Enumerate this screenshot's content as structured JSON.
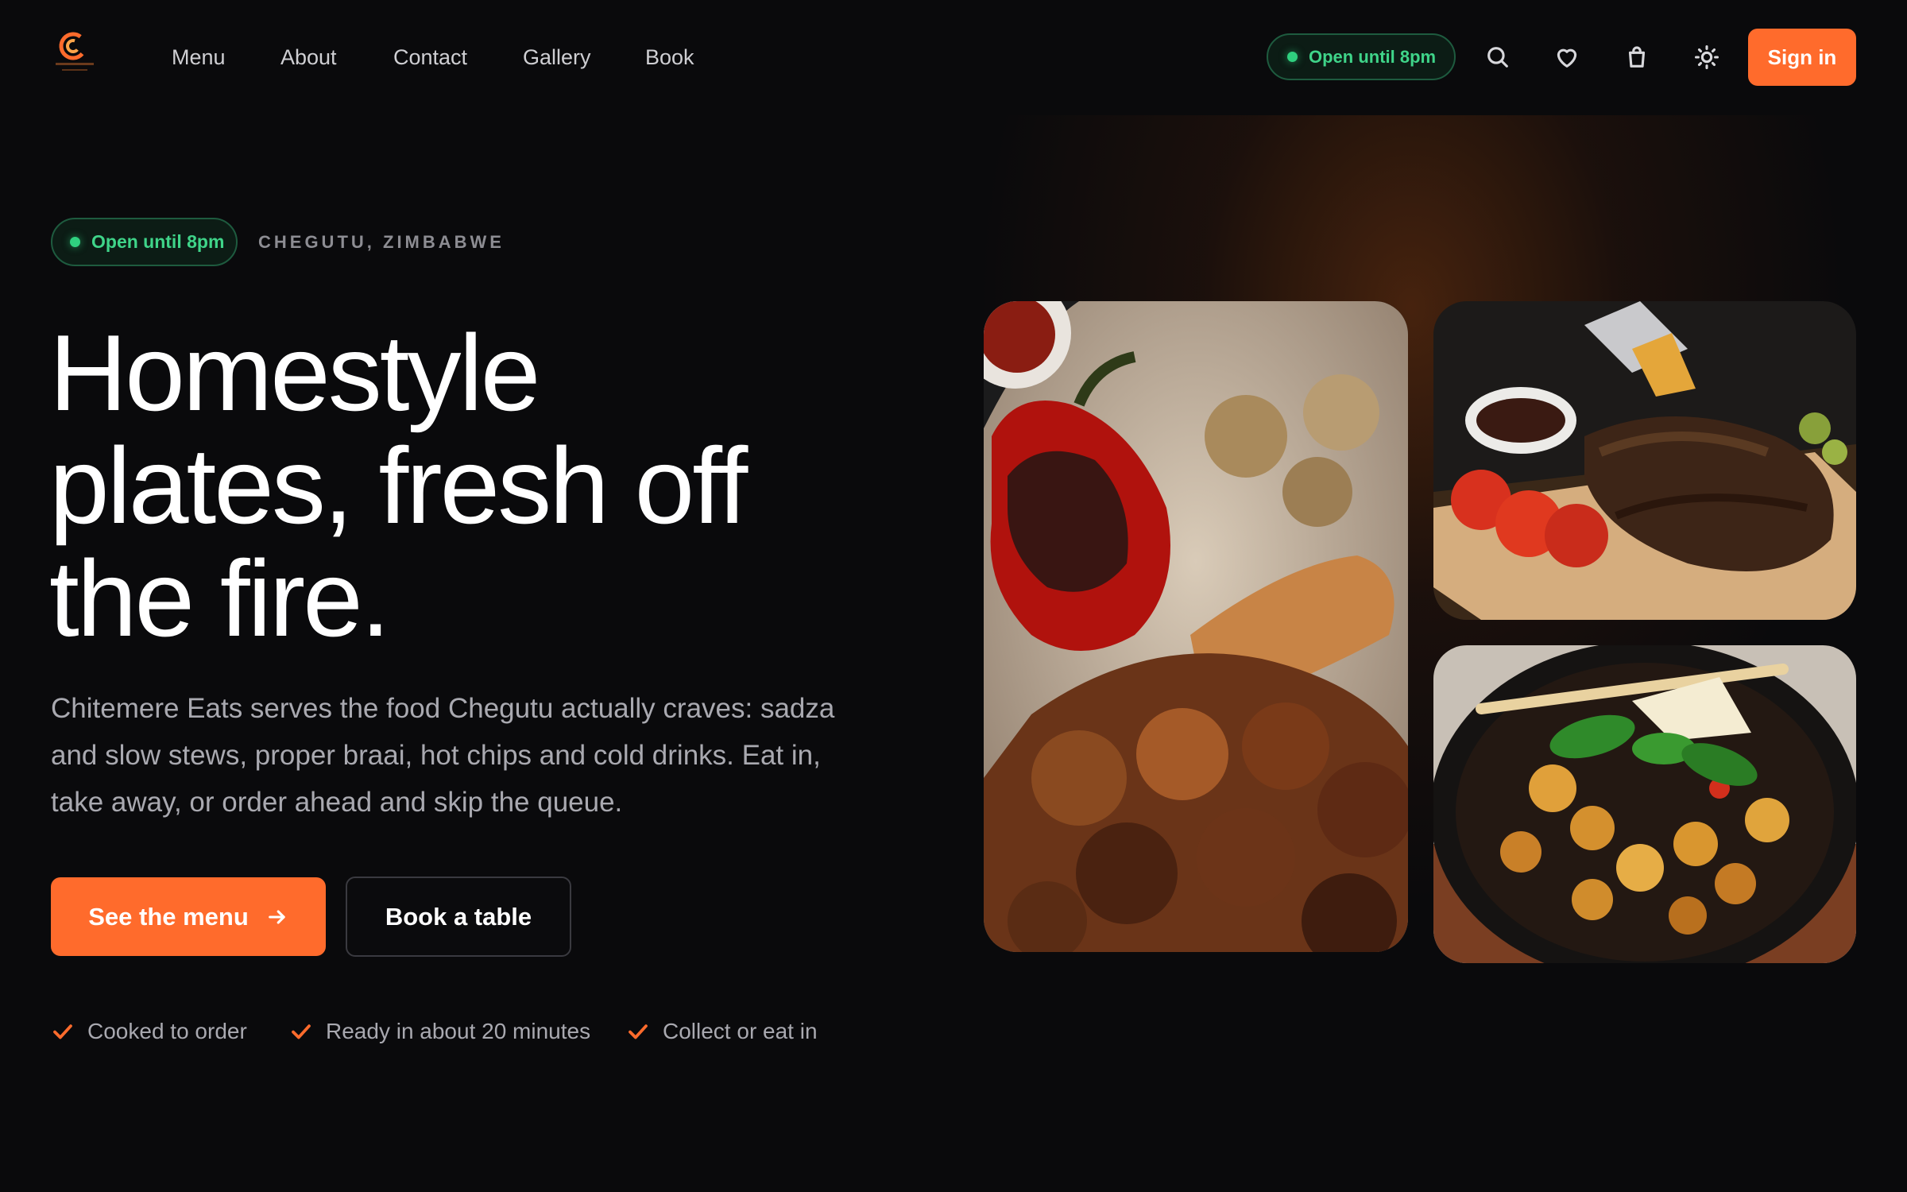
{
  "brand": {
    "logo_text": "CHITEMERE",
    "logo_sub": "EATS"
  },
  "nav": {
    "links": [
      "Menu",
      "About",
      "Contact",
      "Gallery",
      "Book"
    ],
    "status": "Open until 8pm",
    "icons": [
      "search-icon",
      "heart-icon",
      "shopping-bag-icon",
      "sun-icon"
    ],
    "signin": "Sign in"
  },
  "hero": {
    "status": "Open until 8pm",
    "location": "CHEGUTU, ZIMBABWE",
    "headline_lines": [
      "Homestyle",
      "plates, fresh off",
      "the fire."
    ],
    "description_lines": [
      "Chitemere Eats serves the food Chegutu actually craves: sadza",
      "and slow stews, proper braai, hot chips and cold drinks. Eat in,",
      "take away, or order ahead and skip the queue."
    ],
    "primary_cta": "See the menu",
    "secondary_cta": "Book a table",
    "features": [
      "Cooked to order",
      "Ready in about 20 minutes",
      "Collect or eat in"
    ]
  },
  "gallery": {
    "images": [
      "grilled-skewers-photo",
      "ribs-board-photo",
      "chicken-stew-pan-photo"
    ]
  },
  "colors": {
    "accent": "#ff6b2c",
    "status_green": "#2fd07f",
    "background": "#0a0a0c"
  }
}
